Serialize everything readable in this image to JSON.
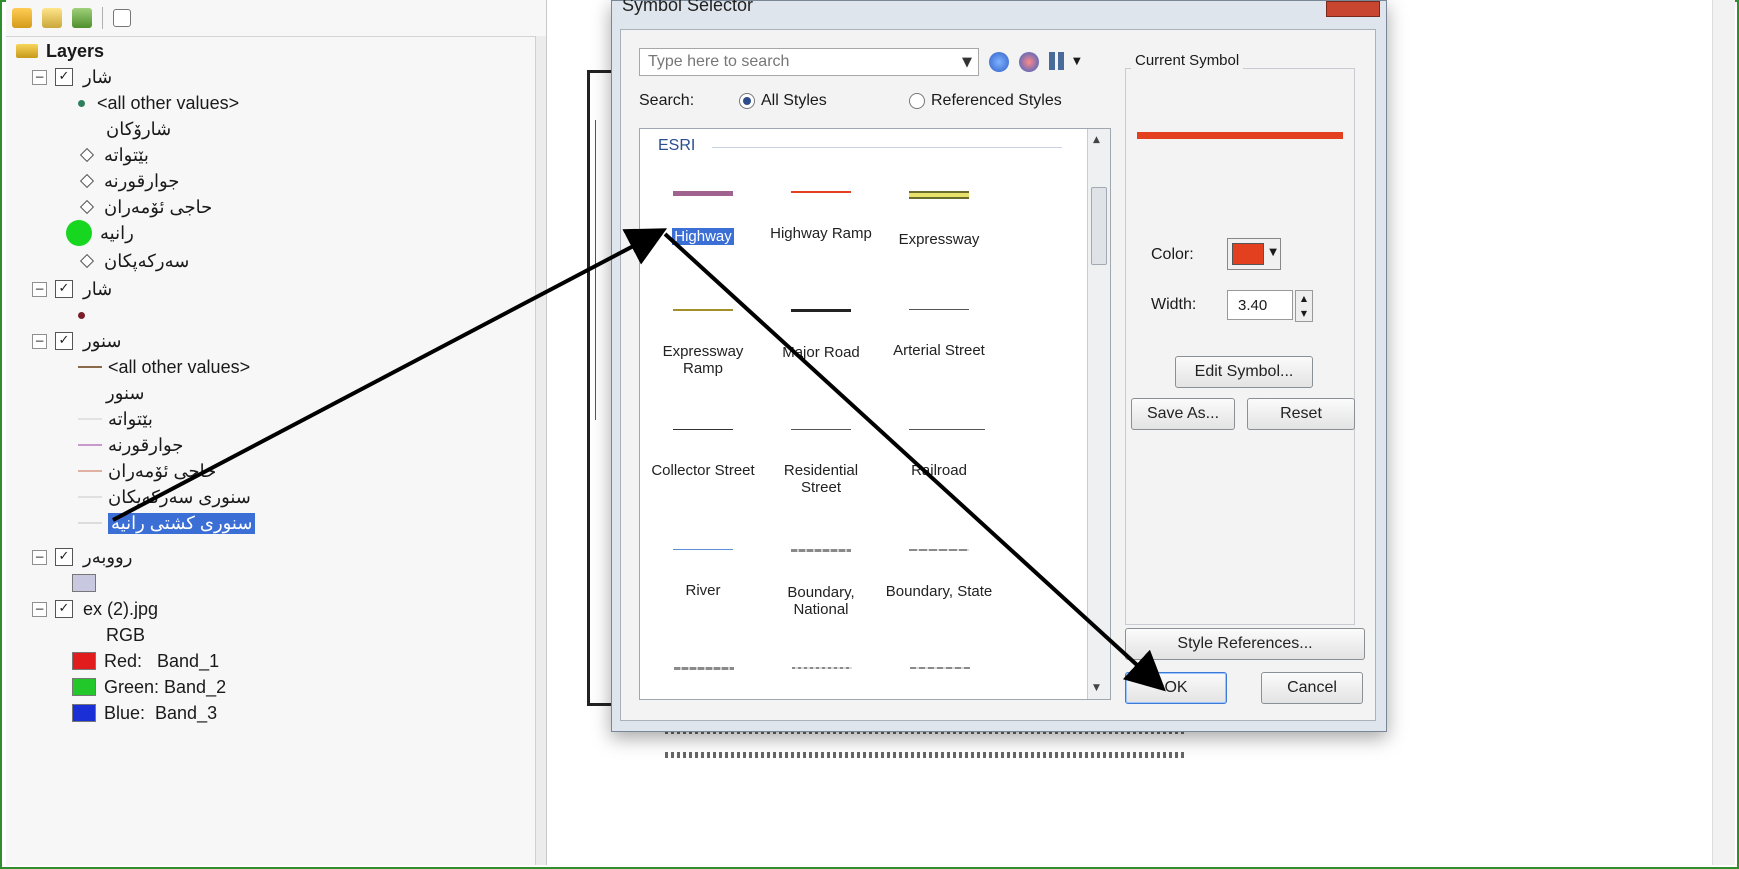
{
  "toc": {
    "title": "Layers",
    "rows": [
      {
        "label": "شار"
      },
      {
        "label": "<all other values>"
      },
      {
        "label": "شارۆكان"
      },
      {
        "label": "بێتواتە"
      },
      {
        "label": "جوارقورنە"
      },
      {
        "label": "حاجى ئۆمەران"
      },
      {
        "label": "رانیە"
      },
      {
        "label": "سەرکەپکان"
      },
      {
        "label": "شار"
      },
      {
        "label": "سنور"
      },
      {
        "label": "<all other values>"
      },
      {
        "label": "سنور"
      },
      {
        "label": "بێتواتە"
      },
      {
        "label": "جوارقورنە"
      },
      {
        "label": "حاجی ئۆمەران"
      },
      {
        "label": "سنوری سەرکەپکان"
      },
      {
        "label": "سنوری کشتی رانیە"
      },
      {
        "label": "رووبەر"
      },
      {
        "label": "ex (2).jpg"
      },
      {
        "label": "RGB"
      },
      {
        "label": "Red:   Band_1"
      },
      {
        "label": "Green: Band_2"
      },
      {
        "label": "Blue:  Band_3"
      }
    ]
  },
  "dialog": {
    "title": "Symbol Selector",
    "search_placeholder": "Type here to search",
    "search_label": "Search:",
    "all_styles": "All Styles",
    "referenced_styles": "Referenced Styles",
    "gallery_header": "ESRI",
    "symbols": [
      {
        "label": "Highway",
        "color": "#a0628f"
      },
      {
        "label": "Highway Ramp",
        "color": "#e2401e"
      },
      {
        "label": "Expressway",
        "color": "#6c6c2c"
      },
      {
        "label": "Expressway Ramp",
        "color": "#a38f2c"
      },
      {
        "label": "Major Road",
        "color": "#222222"
      },
      {
        "label": "Arterial Street",
        "color": "#555555"
      },
      {
        "label": "Collector Street",
        "color": "#333333"
      },
      {
        "label": "Residential Street",
        "color": "#555555"
      },
      {
        "label": "Railroad",
        "color": "#555555"
      },
      {
        "label": "River",
        "color": "#5b8fd6"
      },
      {
        "label": "Boundary, National",
        "color": "#8a8a8a"
      },
      {
        "label": "Boundary, State",
        "color": "#8a8a8a"
      }
    ],
    "current_symbol_label": "Current Symbol",
    "current_symbol_color": "#e2401e",
    "color_label": "Color:",
    "width_label": "Width:",
    "width_value": "3.40",
    "edit_symbol": "Edit Symbol...",
    "save_as": "Save As...",
    "reset": "Reset",
    "style_references": "Style References...",
    "ok": "OK",
    "cancel": "Cancel"
  }
}
